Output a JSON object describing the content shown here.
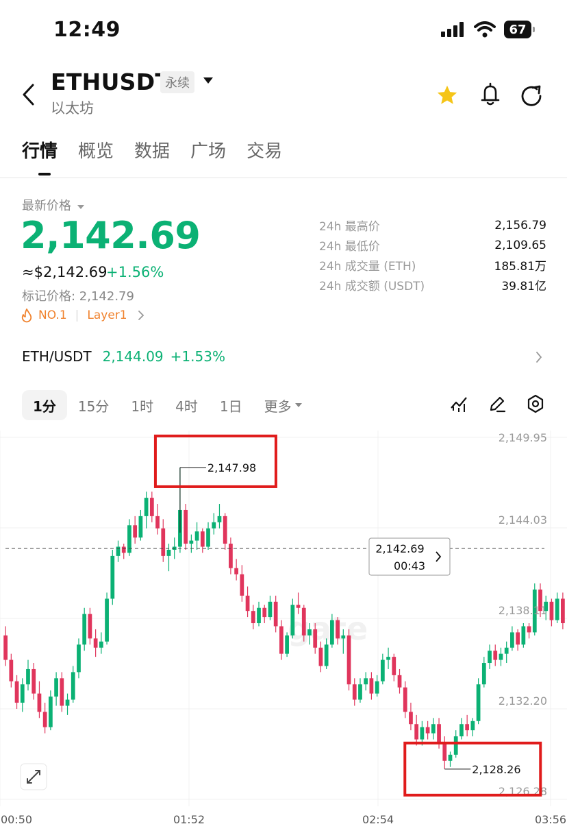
{
  "status_bar": {
    "time": "12:49",
    "battery": "67"
  },
  "header": {
    "symbol": "ETHUSDT",
    "contract_type": "永续",
    "subtitle": "以太坊",
    "icons": [
      "back-icon",
      "dropdown-icon",
      "star-icon",
      "bell-icon",
      "share-icon"
    ],
    "star_color": "#f5c518"
  },
  "tabs": [
    {
      "label": "行情",
      "active": true
    },
    {
      "label": "概览"
    },
    {
      "label": "数据"
    },
    {
      "label": "广场"
    },
    {
      "label": "交易"
    }
  ],
  "ticker": {
    "latest_label": "最新价格",
    "last_price": "2,142.69",
    "usd_price": "≈$2,142.69",
    "change_pct": "+1.56%",
    "mark_price": "标记价格: 2,142.79",
    "rank_tag": "NO.1",
    "category_tag": "Layer1",
    "up_color": "#0bb174",
    "down_color": "#e0355c"
  },
  "stats": [
    {
      "label": "24h 最高价",
      "value": "2,156.79"
    },
    {
      "label": "24h 最低价",
      "value": "2,109.65"
    },
    {
      "label": "24h 成交量 (ETH)",
      "value": "185.81万"
    },
    {
      "label": "24h 成交额 (USDT)",
      "value": "39.81亿"
    }
  ],
  "spot": {
    "pair": "ETH/USDT",
    "price": "2,144.09",
    "change": "+1.53%"
  },
  "intervals": [
    "1分",
    "15分",
    "1时",
    "4时",
    "1日",
    "更多"
  ],
  "active_interval": "1分",
  "chart_data": {
    "type": "candlestick",
    "interval": "1分",
    "y_ticks": [
      2149.95,
      2144.03,
      2138.11,
      2132.2,
      2126.28
    ],
    "y_tick_labels": [
      "2,149.95",
      "2,144.03",
      "2,138.11",
      "2,132.20",
      "2,126.28"
    ],
    "ylim": [
      2126.28,
      2149.95
    ],
    "x_tick_labels": [
      "00:50",
      "01:52",
      "02:54",
      "03:56"
    ],
    "current_price": 2142.69,
    "current_price_label": "2,142.69",
    "countdown": "00:43",
    "annotations": {
      "high": "2,147.98",
      "low": "2,128.26"
    },
    "watermark": "gate",
    "ohlc": [
      [
        2137.0,
        2137.6,
        2135.0,
        2135.4
      ],
      [
        2135.4,
        2135.8,
        2133.6,
        2134.0
      ],
      [
        2134.0,
        2134.4,
        2132.2,
        2132.6
      ],
      [
        2132.6,
        2134.2,
        2132.0,
        2133.8
      ],
      [
        2133.8,
        2135.4,
        2133.4,
        2134.8
      ],
      [
        2134.8,
        2135.2,
        2132.8,
        2133.2
      ],
      [
        2133.2,
        2134.0,
        2131.6,
        2132.0
      ],
      [
        2132.0,
        2132.6,
        2130.6,
        2131.0
      ],
      [
        2131.0,
        2133.4,
        2130.8,
        2133.0
      ],
      [
        2133.0,
        2134.6,
        2132.4,
        2134.2
      ],
      [
        2134.2,
        2134.6,
        2132.0,
        2132.4
      ],
      [
        2132.4,
        2133.2,
        2131.8,
        2132.8
      ],
      [
        2132.8,
        2135.0,
        2132.6,
        2134.6
      ],
      [
        2134.6,
        2136.8,
        2134.2,
        2136.4
      ],
      [
        2136.4,
        2138.8,
        2136.0,
        2138.4
      ],
      [
        2138.4,
        2138.8,
        2136.4,
        2136.8
      ],
      [
        2136.8,
        2137.4,
        2135.6,
        2136.2
      ],
      [
        2136.2,
        2137.2,
        2135.8,
        2136.6
      ],
      [
        2136.6,
        2139.8,
        2136.4,
        2139.4
      ],
      [
        2139.4,
        2142.6,
        2139.0,
        2142.2
      ],
      [
        2142.2,
        2143.2,
        2141.8,
        2142.8
      ],
      [
        2142.8,
        2143.0,
        2142.0,
        2142.4
      ],
      [
        2142.4,
        2144.6,
        2142.2,
        2144.2
      ],
      [
        2144.2,
        2144.8,
        2143.0,
        2143.4
      ],
      [
        2143.4,
        2145.2,
        2143.2,
        2144.8
      ],
      [
        2144.8,
        2146.4,
        2144.0,
        2146.0
      ],
      [
        2146.0,
        2146.4,
        2144.4,
        2144.8
      ],
      [
        2144.8,
        2145.6,
        2143.6,
        2144.0
      ],
      [
        2144.0,
        2144.6,
        2141.8,
        2142.2
      ],
      [
        2142.2,
        2143.0,
        2141.2,
        2142.6
      ],
      [
        2142.6,
        2143.4,
        2142.0,
        2142.8
      ],
      [
        2142.8,
        2147.98,
        2142.4,
        2145.2
      ],
      [
        2145.2,
        2145.6,
        2142.6,
        2143.0
      ],
      [
        2143.0,
        2143.6,
        2142.4,
        2143.2
      ],
      [
        2143.2,
        2144.4,
        2142.6,
        2143.8
      ],
      [
        2143.8,
        2144.0,
        2142.4,
        2142.8
      ],
      [
        2142.8,
        2144.4,
        2142.6,
        2144.0
      ],
      [
        2144.0,
        2145.0,
        2143.6,
        2144.4
      ],
      [
        2144.4,
        2145.6,
        2144.0,
        2144.8
      ],
      [
        2144.8,
        2145.0,
        2142.6,
        2143.0
      ],
      [
        2143.0,
        2143.4,
        2141.0,
        2141.4
      ],
      [
        2141.4,
        2142.0,
        2140.6,
        2141.0
      ],
      [
        2141.0,
        2141.6,
        2139.2,
        2139.6
      ],
      [
        2139.6,
        2140.2,
        2138.2,
        2138.6
      ],
      [
        2138.6,
        2139.0,
        2137.4,
        2137.8
      ],
      [
        2137.8,
        2139.2,
        2137.6,
        2138.8
      ],
      [
        2138.8,
        2139.0,
        2137.8,
        2138.2
      ],
      [
        2138.2,
        2139.6,
        2138.0,
        2139.2
      ],
      [
        2139.2,
        2139.6,
        2137.2,
        2137.6
      ],
      [
        2137.6,
        2138.0,
        2135.4,
        2135.8
      ],
      [
        2135.8,
        2137.2,
        2135.6,
        2137.0
      ],
      [
        2137.0,
        2139.4,
        2136.8,
        2139.0
      ],
      [
        2139.0,
        2139.8,
        2138.4,
        2138.8
      ],
      [
        2138.8,
        2139.0,
        2136.6,
        2137.0
      ],
      [
        2137.0,
        2137.8,
        2136.4,
        2137.4
      ],
      [
        2137.4,
        2137.8,
        2135.8,
        2136.2
      ],
      [
        2136.2,
        2136.6,
        2134.6,
        2135.0
      ],
      [
        2135.0,
        2136.8,
        2134.8,
        2136.4
      ],
      [
        2136.4,
        2138.4,
        2136.2,
        2138.0
      ],
      [
        2138.0,
        2138.2,
        2136.4,
        2136.8
      ],
      [
        2136.8,
        2137.4,
        2135.8,
        2137.0
      ],
      [
        2137.0,
        2137.4,
        2133.4,
        2133.8
      ],
      [
        2133.8,
        2134.2,
        2132.4,
        2132.8
      ],
      [
        2132.8,
        2134.2,
        2132.6,
        2133.8
      ],
      [
        2133.8,
        2134.6,
        2133.4,
        2134.2
      ],
      [
        2134.2,
        2134.6,
        2132.8,
        2133.2
      ],
      [
        2133.2,
        2134.4,
        2133.0,
        2134.0
      ],
      [
        2134.0,
        2135.8,
        2133.8,
        2135.4
      ],
      [
        2135.4,
        2136.2,
        2134.8,
        2135.6
      ],
      [
        2135.6,
        2135.8,
        2134.0,
        2134.4
      ],
      [
        2134.4,
        2134.8,
        2133.2,
        2133.6
      ],
      [
        2133.6,
        2134.0,
        2131.6,
        2132.0
      ],
      [
        2132.0,
        2132.6,
        2130.8,
        2131.2
      ],
      [
        2131.2,
        2131.8,
        2129.8,
        2130.2
      ],
      [
        2130.2,
        2131.4,
        2129.8,
        2131.0
      ],
      [
        2131.0,
        2131.4,
        2130.2,
        2130.6
      ],
      [
        2130.6,
        2131.6,
        2130.2,
        2131.2
      ],
      [
        2131.2,
        2131.6,
        2129.6,
        2130.0
      ],
      [
        2130.0,
        2130.4,
        2128.26,
        2128.8
      ],
      [
        2128.8,
        2129.4,
        2128.4,
        2129.2
      ],
      [
        2129.2,
        2130.8,
        2129.0,
        2130.4
      ],
      [
        2130.4,
        2131.6,
        2130.2,
        2131.2
      ],
      [
        2131.2,
        2131.8,
        2130.4,
        2130.8
      ],
      [
        2130.8,
        2131.6,
        2130.4,
        2131.4
      ],
      [
        2131.4,
        2134.2,
        2131.2,
        2133.8
      ],
      [
        2133.8,
        2135.6,
        2133.6,
        2135.2
      ],
      [
        2135.2,
        2136.4,
        2134.8,
        2136.0
      ],
      [
        2136.0,
        2136.4,
        2135.0,
        2135.4
      ],
      [
        2135.4,
        2136.2,
        2135.0,
        2135.8
      ],
      [
        2135.8,
        2136.6,
        2135.2,
        2136.2
      ],
      [
        2136.2,
        2137.6,
        2136.0,
        2137.2
      ],
      [
        2137.2,
        2137.4,
        2136.0,
        2136.4
      ],
      [
        2136.4,
        2137.8,
        2136.2,
        2137.6
      ],
      [
        2137.6,
        2137.8,
        2136.8,
        2137.2
      ],
      [
        2137.2,
        2140.4,
        2137.0,
        2140.0
      ],
      [
        2140.0,
        2140.4,
        2138.2,
        2138.6
      ],
      [
        2138.6,
        2139.6,
        2138.0,
        2139.2
      ],
      [
        2139.2,
        2139.4,
        2137.6,
        2138.0
      ],
      [
        2138.0,
        2139.8,
        2137.8,
        2139.4
      ],
      [
        2139.4,
        2139.8,
        2137.4,
        2137.8
      ]
    ]
  }
}
